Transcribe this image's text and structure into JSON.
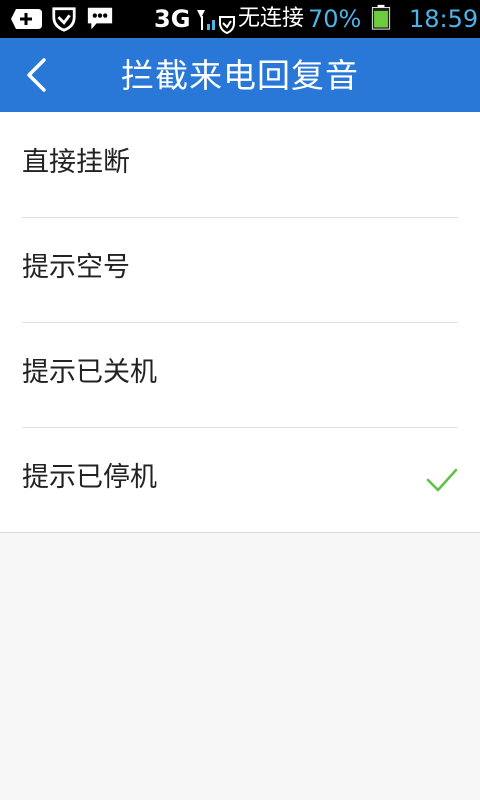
{
  "status_bar": {
    "network": "3G",
    "notification": "无连接",
    "battery_percent": "70%",
    "time": "18:59",
    "icons": [
      "add-icon",
      "shield-icon",
      "message-icon",
      "signal-icon",
      "vpn-icon",
      "battery-icon"
    ]
  },
  "header": {
    "title": "拦截来电回复音",
    "back_icon": "chevron-left-icon"
  },
  "options": [
    {
      "label": "直接挂断",
      "selected": false
    },
    {
      "label": "提示空号",
      "selected": false
    },
    {
      "label": "提示已关机",
      "selected": false
    },
    {
      "label": "提示已停机",
      "selected": true
    }
  ],
  "colors": {
    "header_bg": "#2978d8",
    "status_text_accent": "#4fb3e8",
    "check": "#5cc244",
    "battery": "#6ccc3c"
  }
}
